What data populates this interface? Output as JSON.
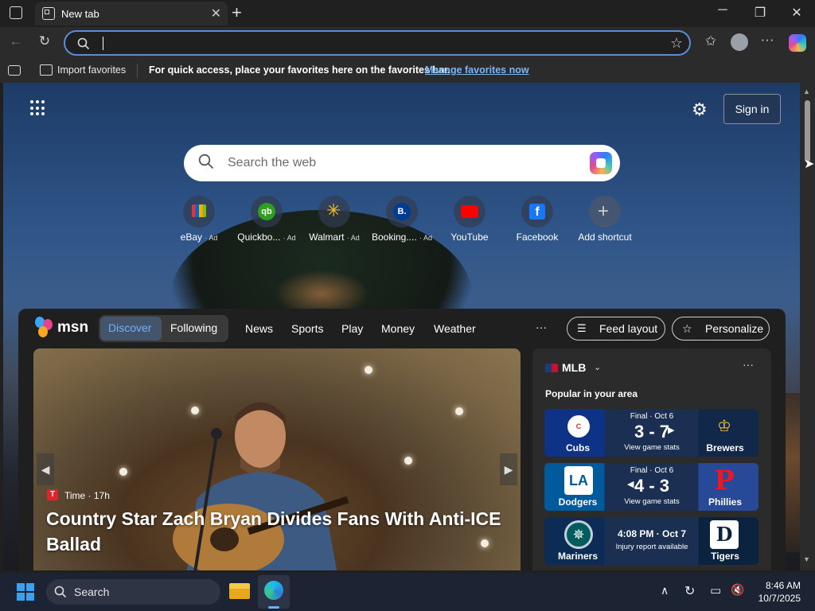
{
  "browser": {
    "tab_title": "New tab",
    "address_value": "",
    "favorites_bar": {
      "import_label": "Import favorites",
      "message": "For quick access, place your favorites here on the favorites bar.",
      "link": "Manage favorites now"
    }
  },
  "newtab": {
    "sign_in": "Sign in",
    "search_placeholder": "Search the web",
    "shortcuts": [
      {
        "label": "eBay",
        "ad": "· Ad",
        "icon": "ebay-icon"
      },
      {
        "label": "Quickbo...",
        "ad": "· Ad",
        "icon": "quickbooks-icon"
      },
      {
        "label": "Walmart",
        "ad": "· Ad",
        "icon": "walmart-icon"
      },
      {
        "label": "Booking....",
        "ad": "· Ad",
        "icon": "booking-icon"
      },
      {
        "label": "YouTube",
        "ad": "",
        "icon": "youtube-icon"
      },
      {
        "label": "Facebook",
        "ad": "",
        "icon": "facebook-icon"
      },
      {
        "label": "Add shortcut",
        "ad": "",
        "icon": "plus-icon"
      }
    ]
  },
  "msn": {
    "logo_text": "msn",
    "tabs": {
      "discover": "Discover",
      "following": "Following"
    },
    "nav": [
      "News",
      "Sports",
      "Play",
      "Money",
      "Weather"
    ],
    "more": "···",
    "feed_layout": "Feed layout",
    "personalize": "Personalize",
    "hero": {
      "source_logo": "T",
      "source": "Time · 17h",
      "headline": "Country Star Zach Bryan Divides Fans With Anti-ICE Ballad"
    },
    "mlb": {
      "title": "MLB",
      "popular": "Popular in your area",
      "games": [
        {
          "status": "Final · Oct 6",
          "score": "3 - 7",
          "sub": "View game stats",
          "team1": "Cubs",
          "team2": "Brewers"
        },
        {
          "status": "Final · Oct 6",
          "score": "4 - 3",
          "sub": "View game stats",
          "team1": "Dodgers",
          "team2": "Phillies"
        },
        {
          "status": "",
          "score": "4:08 PM · Oct 7",
          "sub": "Injury report available",
          "team1": "Mariners",
          "team2": "Tigers"
        }
      ]
    }
  },
  "taskbar": {
    "search": "Search",
    "time": "8:46 AM",
    "date": "10/7/2025"
  },
  "colors": {
    "accent": "#5b8bd9",
    "link": "#7ab4f5"
  }
}
